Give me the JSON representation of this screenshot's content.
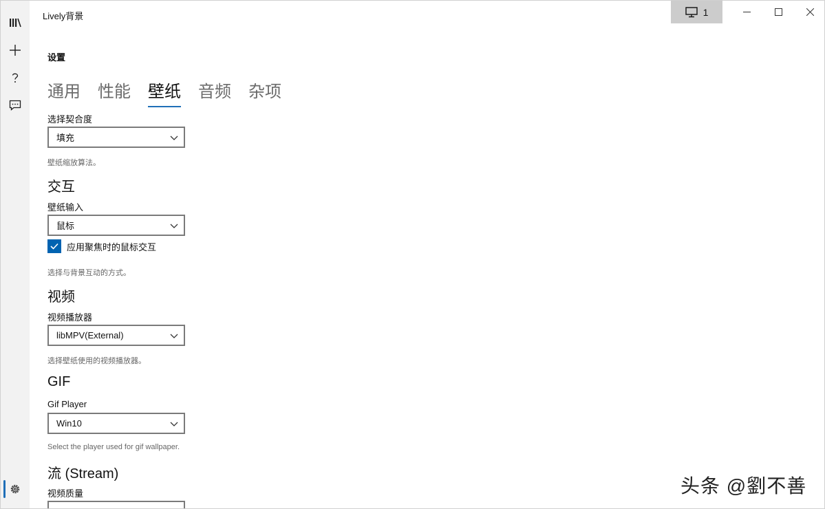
{
  "window": {
    "title": "Lively背景"
  },
  "titlebar": {
    "monitor_count": "1"
  },
  "rail": {
    "items": [
      {
        "name": "library",
        "icon": "library-icon"
      },
      {
        "name": "add",
        "icon": "add-icon"
      },
      {
        "name": "help",
        "icon": "help-icon"
      },
      {
        "name": "feedback",
        "icon": "feedback-icon"
      }
    ],
    "settings_icon": "gear-icon"
  },
  "page": {
    "title": "设置"
  },
  "tabs": [
    {
      "label": "通用",
      "active": false
    },
    {
      "label": "性能",
      "active": false
    },
    {
      "label": "壁纸",
      "active": true
    },
    {
      "label": "音频",
      "active": false
    },
    {
      "label": "杂项",
      "active": false
    }
  ],
  "fit": {
    "label": "选择契合度",
    "value": "填充",
    "hint": "壁纸缩放算法。"
  },
  "interaction": {
    "heading": "交互",
    "input_label": "壁纸输入",
    "input_value": "鼠标",
    "checkbox_label": "应用聚焦时的鼠标交互",
    "checkbox_checked": true,
    "hint": "选择与背景互动的方式。"
  },
  "video": {
    "heading": "视频",
    "player_label": "视频播放器",
    "player_value": "libMPV(External)",
    "hint": "选择壁纸使用的视频播放器。"
  },
  "gif": {
    "heading": "GIF",
    "player_label": "Gif Player",
    "player_value": "Win10",
    "hint": "Select the player used for gif wallpaper."
  },
  "stream": {
    "heading": "流 (Stream)",
    "quality_label": "视频质量"
  },
  "watermark": "头条 @劉不善",
  "colors": {
    "accent": "#0063b1",
    "rail_bg": "#f2f2f2"
  }
}
